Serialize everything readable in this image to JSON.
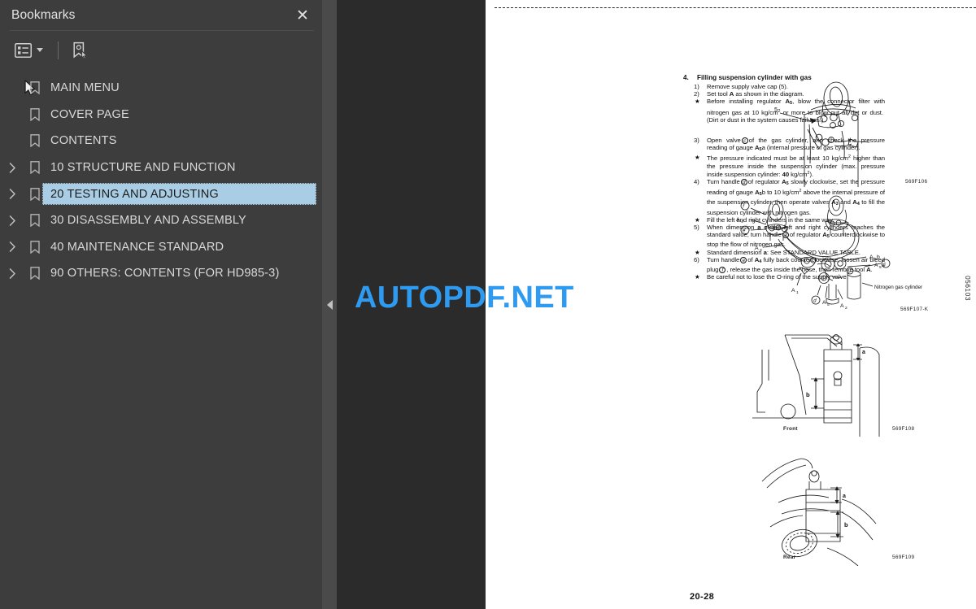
{
  "panel": {
    "title": "Bookmarks",
    "close_label": "✕",
    "toolbar": {
      "options_icon": "list-options-icon",
      "options_label": "Bookmark options",
      "new_bookmark_icon": "new-bookmark-icon",
      "new_bookmark_label": "New bookmark"
    },
    "items": [
      {
        "label": "MAIN MENU",
        "expandable": false,
        "selected": false
      },
      {
        "label": "COVER PAGE",
        "expandable": false,
        "selected": false
      },
      {
        "label": "CONTENTS",
        "expandable": false,
        "selected": false
      },
      {
        "label": "10  STRUCTURE AND FUNCTION",
        "expandable": true,
        "selected": false
      },
      {
        "label": "20  TESTING AND ADJUSTING",
        "expandable": true,
        "selected": true
      },
      {
        "label": "30  DISASSEMBLY AND ASSEMBLY",
        "expandable": true,
        "selected": false
      },
      {
        "label": "40  MAINTENANCE STANDARD",
        "expandable": true,
        "selected": false
      },
      {
        "label": "90  OTHERS:  CONTENTS (FOR HD985-3)",
        "expandable": true,
        "selected": false
      }
    ]
  },
  "collapse_handle": {
    "name": "collapse-panel-handle"
  },
  "watermark": {
    "text": "AUTOPDF.NET",
    "color": "#2e9bf0"
  },
  "document": {
    "page_number": "20-28",
    "vertical_code": "056103",
    "section": {
      "number": "4.",
      "title": "Filling suspension cylinder with gas"
    },
    "steps": [
      {
        "marker": "1)",
        "text": "Remove supply valve cap (5)."
      },
      {
        "marker": "2)",
        "text": "Set tool A as shown in the diagram."
      },
      {
        "marker": "★",
        "text": "Before installing regulator A5, blow the connector filter with nitrogen gas at 10 kg/cm2 or more to blow out all dirt or dust.  (Dirt or dust in the system causes failures.)"
      },
      {
        "marker": "3)",
        "text": "Open valve (c) of the gas cylinder, and check the pressure reading of gauge A5 a (internal pressure of gas cylinder)."
      },
      {
        "marker": "★",
        "text": "The pressure indicated must be at least 10 kg/cm2 higher than the pressure inside the suspension cylinder (max. pressure inside suspension cylinder: 40 kg/cm2)."
      },
      {
        "marker": "4)",
        "text": "Turn handle (d) of regulator A5 slowly clockwise, set the pressure reading of gauge A5 b to 10 kg/cm2 above the internal pressure of the suspension cylinder, then operate valves A3 and A4 to fill the suspension cylinder with nitrogen gas."
      },
      {
        "marker": "★",
        "text": "Fill the left and right cylinders in the same way."
      },
      {
        "marker": "5)",
        "text": "When dimension a of the left and right cylinders reaches the standard value, turn handle (d) of regulator A5 counterclockwise to stop the flow of nitrogen gas."
      },
      {
        "marker": "★",
        "text": "Standard dimension a: See STANDARD VALUE TABLE."
      },
      {
        "marker": "6)",
        "text": "Turn handle (e) of A4 fully back counterclockwise, loosen air bleed plug (f), release the gas inside the hose, then remove tool A."
      },
      {
        "marker": "★",
        "text": "Be careful not to lose the O-ring of the supply valve."
      }
    ],
    "figures": [
      {
        "code": "569F106",
        "caption": "",
        "callouts": [
          "5"
        ]
      },
      {
        "code": "569F107-K",
        "caption": "",
        "callouts": [
          "A1",
          "A2",
          "A3",
          "A4",
          "A5",
          "A5a",
          "A5b",
          "c",
          "d",
          "e",
          "f",
          "Nitrogen gas cylinder"
        ]
      },
      {
        "code": "569F108",
        "caption": "Front",
        "callouts": [
          "a",
          "b"
        ]
      },
      {
        "code": "569F109",
        "caption": "Rear",
        "callouts": [
          "a",
          "b"
        ]
      }
    ]
  }
}
